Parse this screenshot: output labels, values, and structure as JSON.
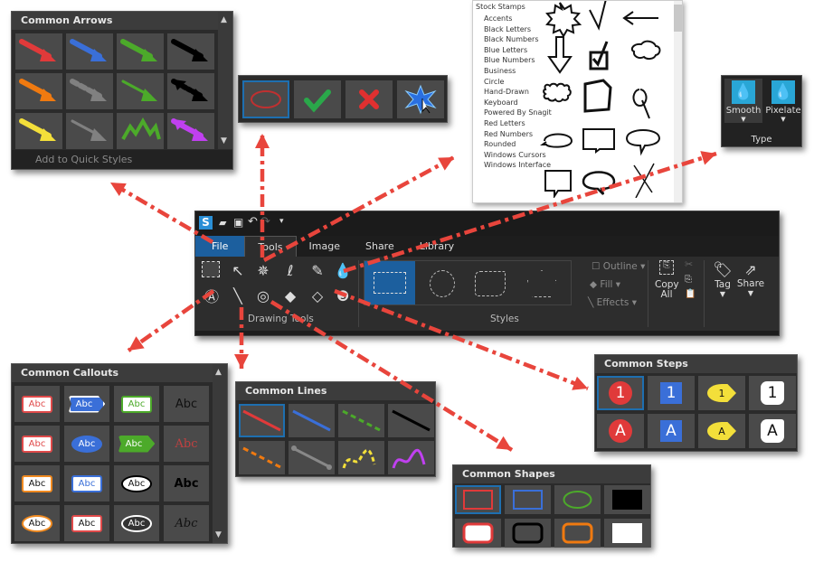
{
  "arrows_panel": {
    "title": "Common Arrows",
    "footer": "Add to Quick Styles",
    "items": [
      {
        "color": "#e03a3a",
        "style": "solid"
      },
      {
        "color": "#3a6fd8",
        "style": "solid"
      },
      {
        "color": "#4caa2a",
        "style": "solid"
      },
      {
        "color": "#000000",
        "style": "solid"
      },
      {
        "color": "#f07a10",
        "style": "solid"
      },
      {
        "color": "#808080",
        "style": "dashed"
      },
      {
        "color": "#4caa2a",
        "style": "thin"
      },
      {
        "color": "#000000",
        "style": "dotted-double"
      },
      {
        "color": "#f3df3a",
        "style": "solid"
      },
      {
        "color": "#808080",
        "style": "thin"
      },
      {
        "color": "#4caa2a",
        "style": "zigzag"
      },
      {
        "color": "#c040f0",
        "style": "double"
      }
    ]
  },
  "stamp_toolbar": {
    "items": [
      "ellipse-outline",
      "checkmark",
      "x-mark",
      "starburst-cursor"
    ]
  },
  "stamps_panel": {
    "category": "Stock Stamps",
    "subcategories": [
      "Accents",
      "Black Letters",
      "Black Numbers",
      "Blue Letters",
      "Blue Numbers",
      "Business",
      "Circle",
      "Hand-Drawn",
      "Keyboard",
      "Powered By Snagit",
      "Red Letters",
      "Red Numbers",
      "Rounded",
      "Windows Cursors",
      "Windows Interface"
    ]
  },
  "type_panel": {
    "options": [
      {
        "label": "Smooth"
      },
      {
        "label": "Pixelate"
      }
    ],
    "group_label": "Type"
  },
  "main_window": {
    "tabs": [
      {
        "label": "File"
      },
      {
        "label": "Tools"
      },
      {
        "label": "Image"
      },
      {
        "label": "Share"
      },
      {
        "label": "Library"
      }
    ],
    "active_tab": "Tools",
    "drawing_tools_label": "Drawing Tools",
    "styles_label": "Styles",
    "outline_label": "Outline",
    "fill_label": "Fill",
    "effects_label": "Effects",
    "copy_all_label": "Copy All",
    "tag_label": "Tag",
    "share_label": "Share"
  },
  "callouts_panel": {
    "title": "Common Callouts",
    "items": [
      {
        "text": "Abc",
        "bg": "#ffffff",
        "border": "#e04a4a",
        "fg": "#e04a4a"
      },
      {
        "text": "Abc",
        "bg": "#3a6fd8",
        "border": "#ffffff",
        "fg": "#ffffff"
      },
      {
        "text": "Abc",
        "bg": "#ffffff",
        "border": "#4caa2a",
        "fg": "#4caa2a"
      },
      {
        "text": "Abc",
        "bg": "transparent",
        "border": "transparent",
        "fg": "#111111"
      },
      {
        "text": "Abc",
        "bg": "#ffffff",
        "border": "#e04a4a",
        "fg": "#e04a4a"
      },
      {
        "text": "Abc",
        "bg": "#3a6fd8",
        "border": "#3a6fd8",
        "fg": "#ffffff"
      },
      {
        "text": "Abc",
        "bg": "#4caa2a",
        "border": "#4caa2a",
        "fg": "#ffffff"
      },
      {
        "text": "Abc",
        "bg": "transparent",
        "border": "transparent",
        "fg": "#c04040"
      },
      {
        "text": "Abc",
        "bg": "#ffffff",
        "border": "#f08a20",
        "fg": "#111111"
      },
      {
        "text": "Abc",
        "bg": "#ffffff",
        "border": "#3a6fd8",
        "fg": "#3a6fd8"
      },
      {
        "text": "Abc",
        "bg": "#ffffff",
        "border": "#000000",
        "fg": "#111111"
      },
      {
        "text": "Abc",
        "bg": "transparent",
        "border": "transparent",
        "fg": "#000000"
      },
      {
        "text": "Abc",
        "bg": "#ffffff",
        "border": "#f08a20",
        "fg": "#111111"
      },
      {
        "text": "Abc",
        "bg": "#ffffff",
        "border": "#e04a4a",
        "fg": "#111111"
      },
      {
        "text": "Abc",
        "bg": "#333333",
        "border": "#ffffff",
        "fg": "#ffffff"
      },
      {
        "text": "Abc",
        "bg": "transparent",
        "border": "transparent",
        "fg": "#111111"
      }
    ]
  },
  "lines_panel": {
    "title": "Common Lines",
    "items": [
      {
        "color": "#e03a3a",
        "style": "solid"
      },
      {
        "color": "#3a6fd8",
        "style": "solid"
      },
      {
        "color": "#4caa2a",
        "style": "dashed"
      },
      {
        "color": "#000000",
        "style": "solid"
      },
      {
        "color": "#f07a10",
        "style": "dashed"
      },
      {
        "color": "#888888",
        "style": "dots-ends"
      },
      {
        "color": "#f3df3a",
        "style": "wavy-dashed"
      },
      {
        "color": "#c040f0",
        "style": "wavy"
      }
    ]
  },
  "steps_panel": {
    "title": "Common Steps",
    "items": [
      {
        "text": "1",
        "shape": "circle",
        "bg": "#e03a3a",
        "fg": "#ffffff"
      },
      {
        "text": "1",
        "shape": "square",
        "bg": "#3a6fd8",
        "fg": "#ffffff"
      },
      {
        "text": "1",
        "shape": "drop",
        "bg": "#f3df3a",
        "fg": "#111111"
      },
      {
        "text": "1",
        "shape": "rounded",
        "bg": "#ffffff",
        "fg": "#111111"
      },
      {
        "text": "A",
        "shape": "circle",
        "bg": "#e03a3a",
        "fg": "#ffffff"
      },
      {
        "text": "A",
        "shape": "square",
        "bg": "#3a6fd8",
        "fg": "#ffffff"
      },
      {
        "text": "A",
        "shape": "drop",
        "bg": "#f3df3a",
        "fg": "#111111"
      },
      {
        "text": "A",
        "shape": "rounded",
        "bg": "#ffffff",
        "fg": "#111111"
      }
    ]
  },
  "shapes_panel": {
    "title": "Common Shapes",
    "items": [
      {
        "shape": "rect",
        "stroke": "#e03a3a",
        "fill": "none"
      },
      {
        "shape": "rect",
        "stroke": "#3a6fd8",
        "fill": "none"
      },
      {
        "shape": "ellipse",
        "stroke": "#4caa2a",
        "fill": "none"
      },
      {
        "shape": "rect",
        "stroke": "#000000",
        "fill": "#000000"
      },
      {
        "shape": "roundrect",
        "stroke": "#e03a3a",
        "fill": "#ffffff"
      },
      {
        "shape": "roundrect",
        "stroke": "#000000",
        "fill": "none"
      },
      {
        "shape": "roundrect",
        "stroke": "#f07a10",
        "fill": "none"
      },
      {
        "shape": "rect",
        "stroke": "#ffffff",
        "fill": "#ffffff"
      }
    ]
  },
  "accent_color": "#e8453c"
}
